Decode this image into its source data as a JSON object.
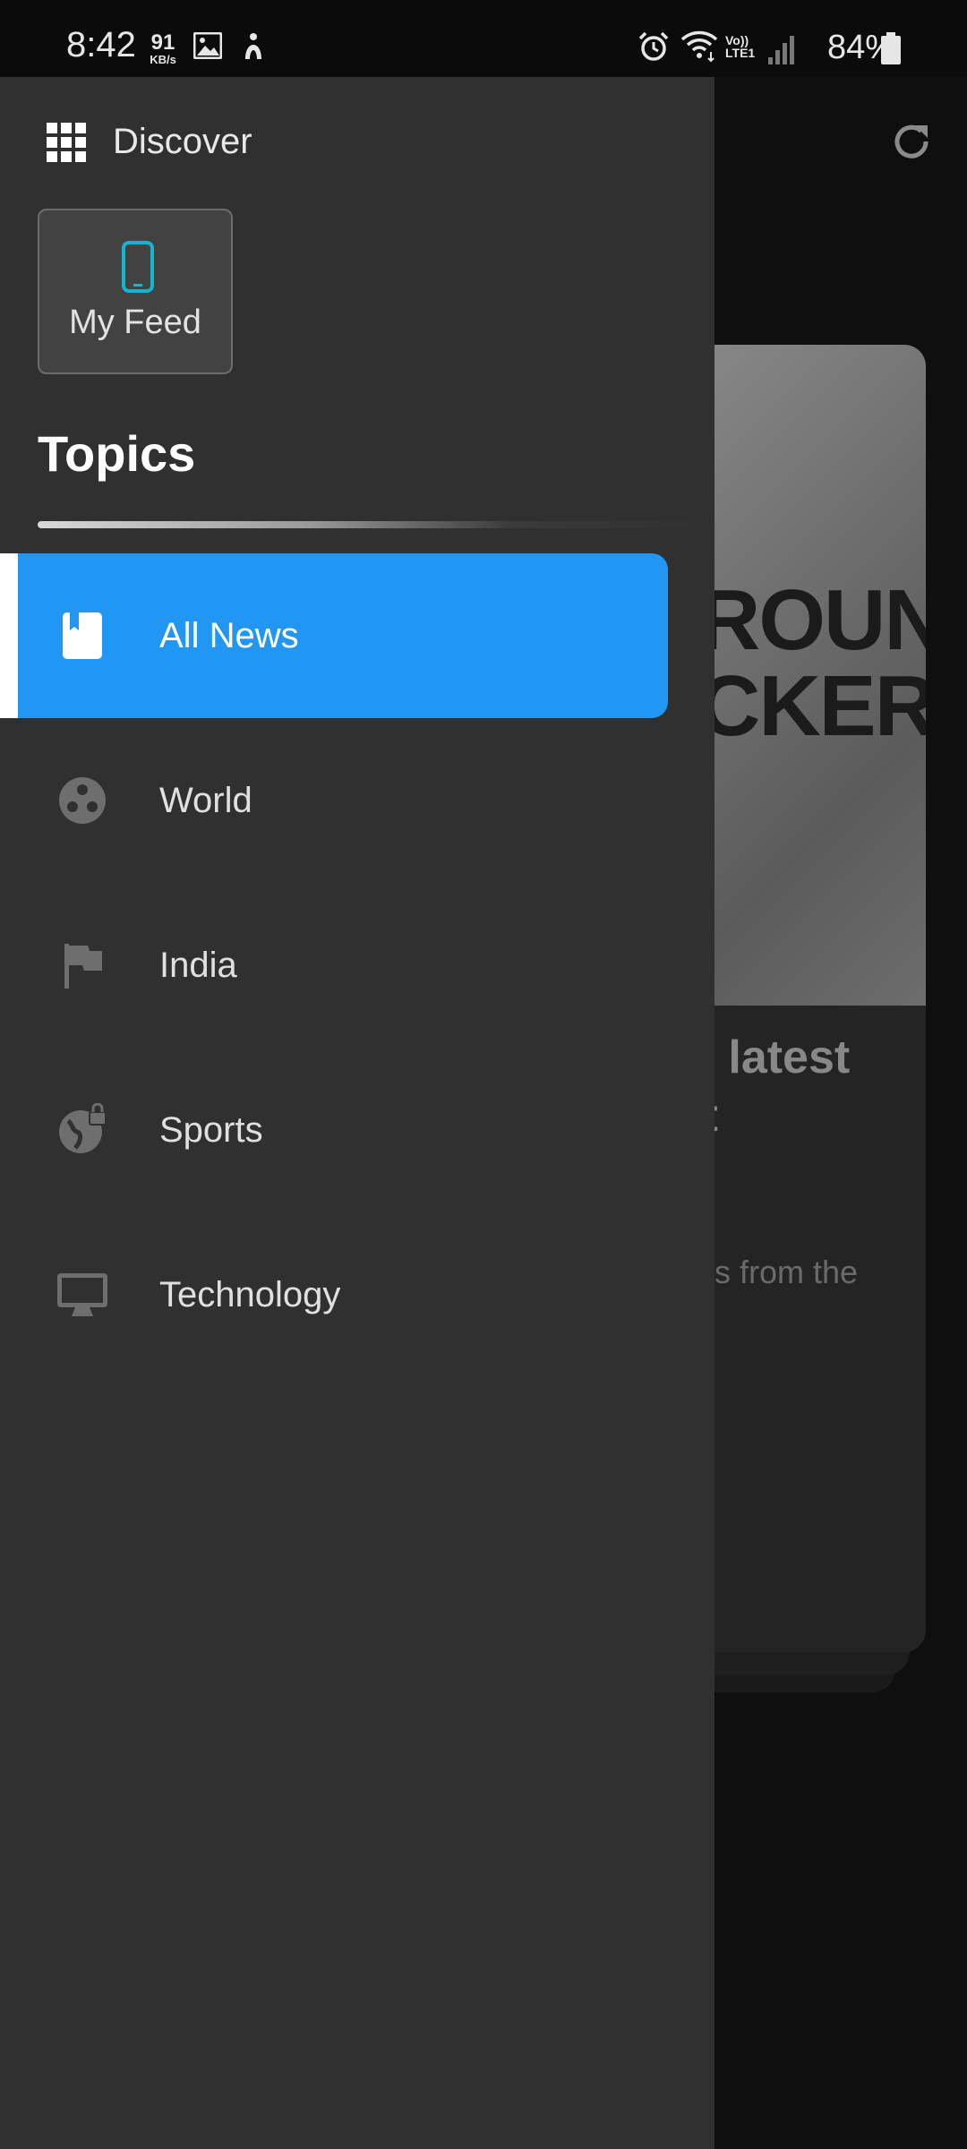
{
  "status_bar": {
    "time": "8:42",
    "speed_value": "91",
    "speed_unit": "KB/s",
    "lte_label": "Vo)) LTE1",
    "battery": "84%",
    "icons": [
      "image-icon",
      "accessibility-icon",
      "alarm-icon",
      "wifi-icon",
      "signal-icon",
      "battery-icon"
    ]
  },
  "drawer": {
    "header_label": "Discover",
    "my_feed_label": "My Feed",
    "topics_heading": "Topics",
    "accent_color": "#2196f3",
    "my_feed_icon_color": "#16b4d3",
    "items": [
      {
        "label": "All News",
        "icon": "book-icon",
        "active": true
      },
      {
        "label": "World",
        "icon": "globe-dots-icon",
        "active": false
      },
      {
        "label": "India",
        "icon": "flag-icon",
        "active": false
      },
      {
        "label": "Sports",
        "icon": "globe-lock-icon",
        "active": false
      },
      {
        "label": "Technology",
        "icon": "monitor-icon",
        "active": false
      }
    ]
  },
  "background": {
    "card_image_text": "ROUND\nCKER",
    "card_title_fragment": "e latest\nit",
    "card_subtitle_fragment": "ies from the"
  }
}
